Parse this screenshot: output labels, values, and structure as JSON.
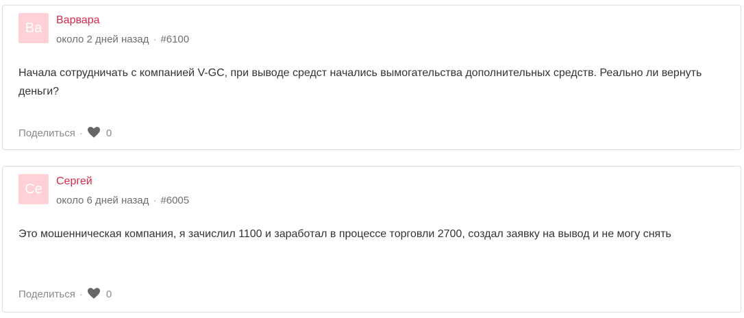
{
  "comments": [
    {
      "avatar_initials": "Ва",
      "author": "Варвара",
      "time": "около 2 дней назад",
      "separator": "·",
      "number": "#6100",
      "text": "Начала сотрудничать с компанией V-GC, при выводе средст начались вымогательства дополнительных средств. Реально ли вернуть деньги?",
      "share_label": "Поделиться",
      "likes": "0"
    },
    {
      "avatar_initials": "Се",
      "author": "Сергей",
      "time": "около 6 дней назад",
      "separator": "·",
      "number": "#6005",
      "text": "Это мошенническая компания, я зачислил 1100 и заработал в процессе торговли 2700, создал заявку на вывод и не могу снять",
      "share_label": "Поделиться",
      "likes": "0"
    }
  ],
  "colors": {
    "avatar_bg": "#ffd1d6",
    "author": "#d6294b",
    "heart": "#666666"
  },
  "icons": {
    "like": "heart-icon"
  }
}
